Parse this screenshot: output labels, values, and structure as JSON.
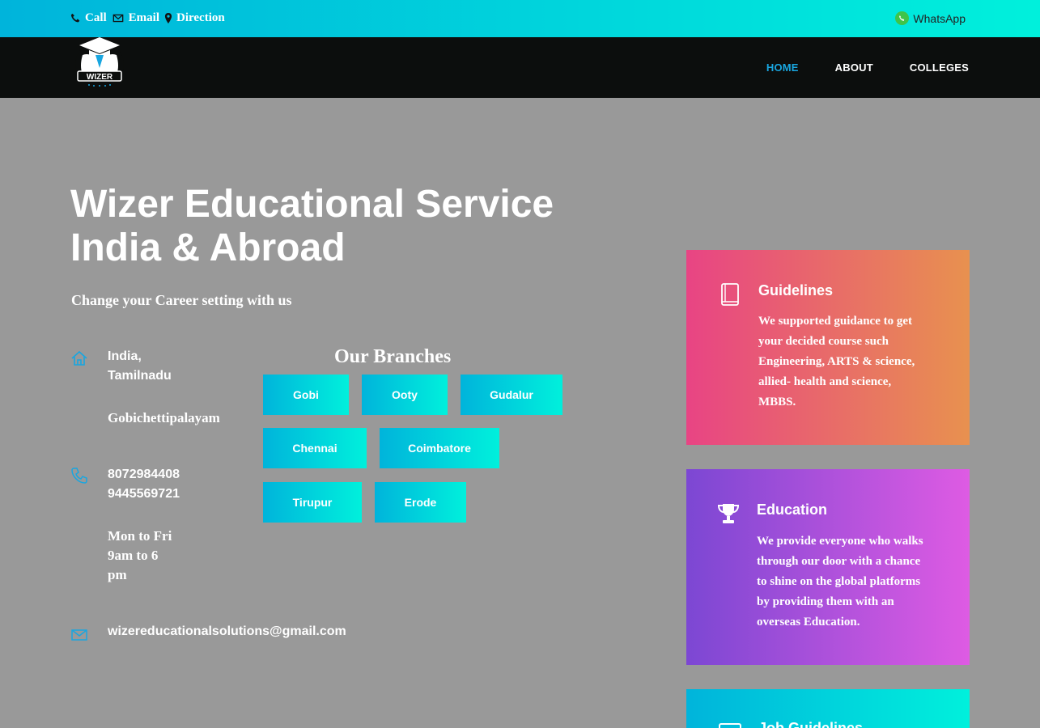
{
  "topbar": {
    "call_label": "Call",
    "email_label": "Email",
    "direction_label": "Direction",
    "whatsapp_label": "WhatsApp"
  },
  "nav": {
    "logo_text": "WIZER",
    "items": [
      {
        "label": "HOME",
        "active": true
      },
      {
        "label": "ABOUT",
        "active": false
      },
      {
        "label": "COLLEGES",
        "active": false
      }
    ]
  },
  "hero": {
    "title_line1": "Wizer Educational Service",
    "title_line2": "India & Abroad",
    "subtitle": "Change your Career setting with us"
  },
  "contact": {
    "location_line1": "India,",
    "location_line2": "Tamilnadu",
    "city": "Gobichettipalayam",
    "phone1": "8072984408",
    "phone2": "9445569721",
    "hours_line1": "Mon to Fri",
    "hours_line2": "9am to 6",
    "hours_line3": "pm",
    "email": "wizereducationalsolutions@gmail.com"
  },
  "branches": {
    "title": "Our Branches",
    "items": [
      "Gobi",
      "Ooty",
      "Gudalur",
      "Chennai",
      "Coimbatore",
      "Tirupur",
      "Erode"
    ]
  },
  "cards": [
    {
      "title": "Guidelines",
      "icon": "book-icon",
      "lines": [
        "We supported guidance to get",
        "your decided course such",
        "Engineering, ARTS & science,",
        "allied- health and science,",
        "MBBS."
      ]
    },
    {
      "title": "Education",
      "icon": "trophy-icon",
      "lines": [
        "We provide everyone who walks",
        "through our door with a chance",
        "to shine on the global platforms",
        "by providing them with an",
        "overseas Education."
      ]
    },
    {
      "title": "Job Guidelines",
      "icon": "briefcase-icon",
      "lines": []
    }
  ],
  "colors": {
    "accent_blue": "#19a6e0",
    "gradient_cyan_start": "#00b4db",
    "gradient_cyan_end": "#00f0dc",
    "card1_start": "#e84484",
    "card1_end": "#e8914f",
    "card2_start": "#7c47d3",
    "card2_end": "#de5be3",
    "page_bg": "#999999",
    "nav_bg": "#0c0e0d"
  }
}
